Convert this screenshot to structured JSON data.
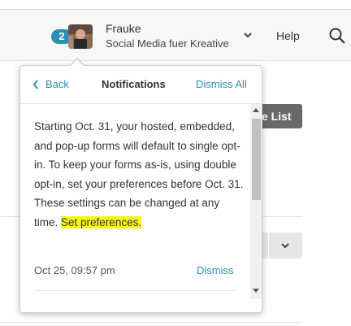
{
  "header": {
    "notification_count": "2",
    "user_name": "Frauke",
    "user_org": "Social Media fuer Kreative",
    "help_label": "Help",
    "icons": [
      "chevron-down-icon",
      "search-icon"
    ]
  },
  "background": {
    "button_label_partial": "e List"
  },
  "notifications": {
    "back_label": "Back",
    "title": "Notifications",
    "dismiss_all_label": "Dismiss All",
    "items": [
      {
        "text": "Starting Oct. 31, your hosted, embedded, and pop-up forms will default to single opt-in. To keep your forms as-is, using double opt-in, set your preferences before Oct. 31. These settings can be changed at any time.",
        "link_text": "Set preferences.",
        "timestamp": "Oct 25, 09:57 pm",
        "dismiss_label": "Dismiss"
      }
    ]
  },
  "colors": {
    "accent": "#2b8eb3",
    "highlight": "#f7f71a",
    "button_bg": "#696969"
  }
}
